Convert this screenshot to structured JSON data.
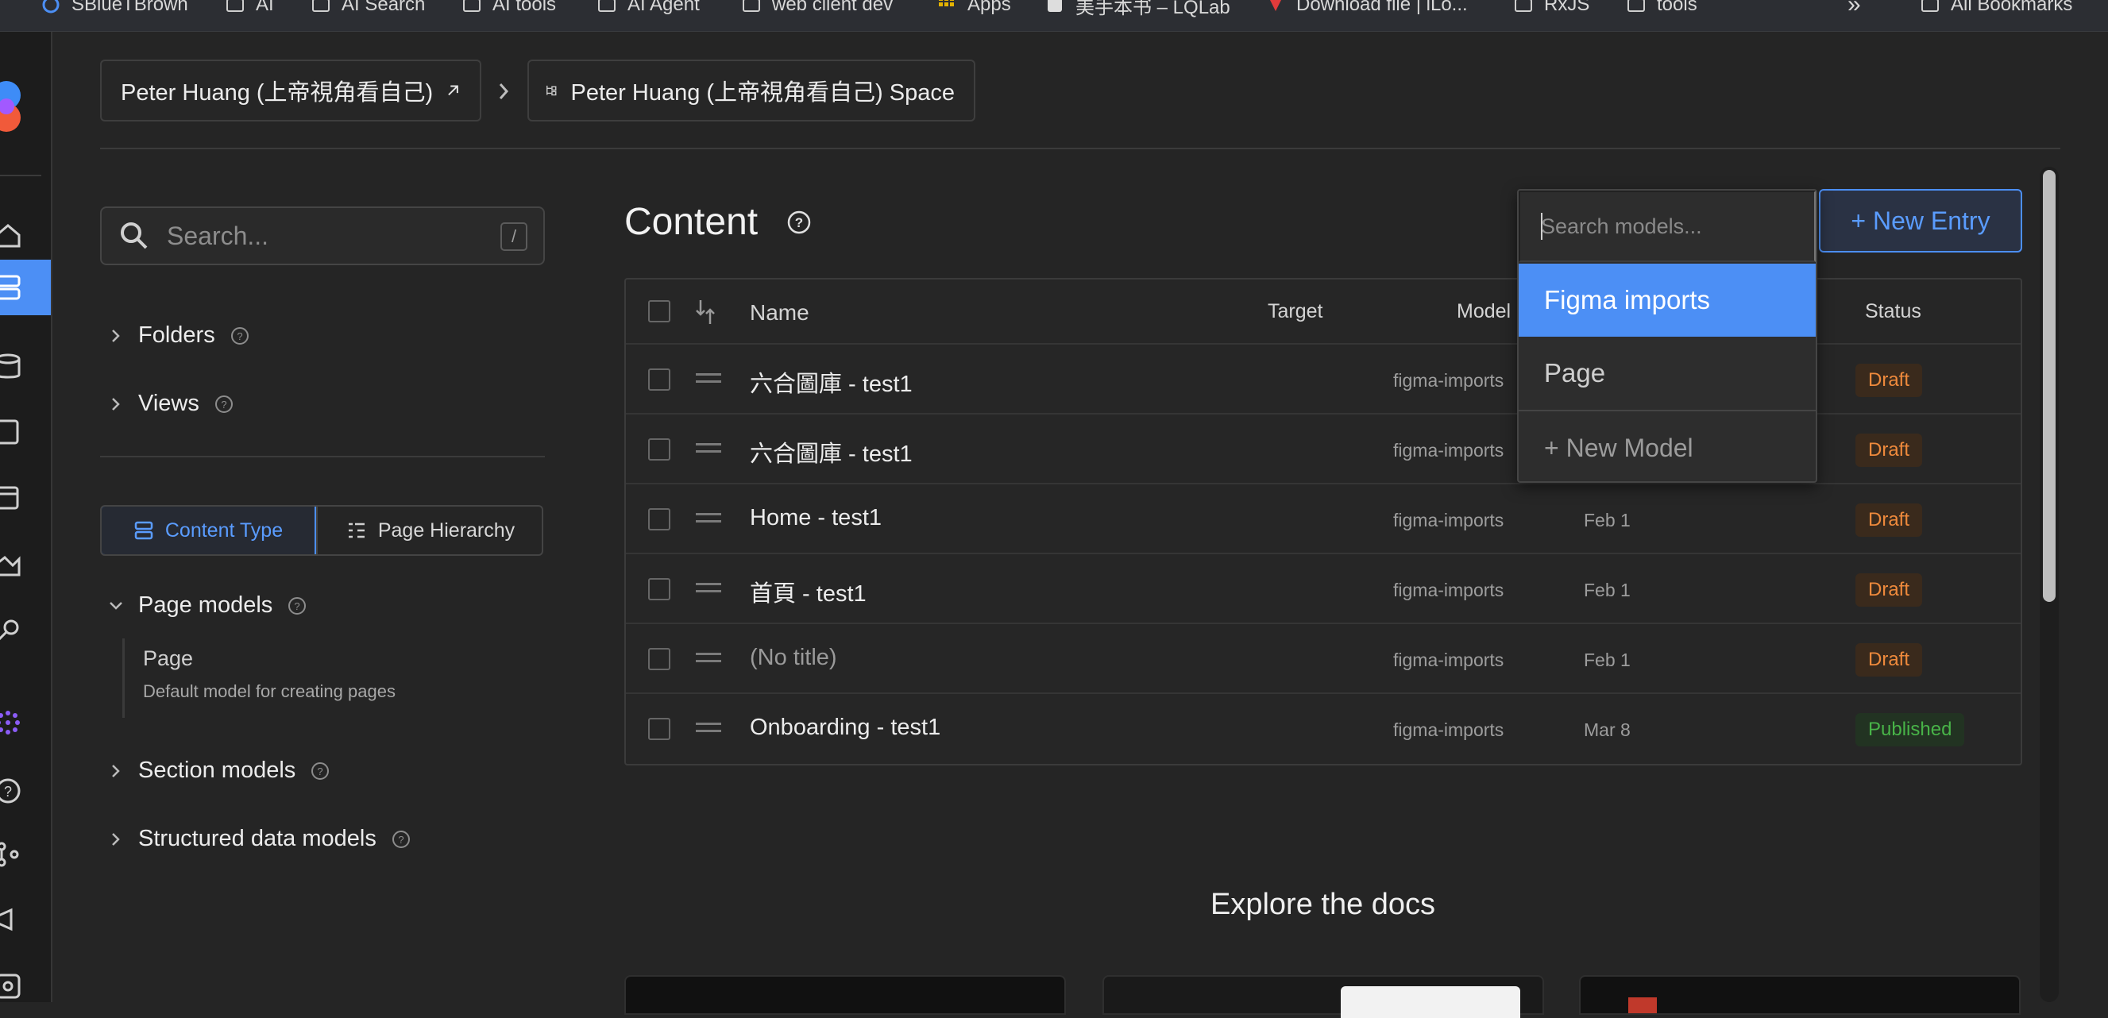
{
  "bookmarks": [
    {
      "label": "SBlueTBrown",
      "icon": "globe-icon"
    },
    {
      "label": "AI",
      "icon": "folder-icon"
    },
    {
      "label": "AI Search",
      "icon": "folder-icon"
    },
    {
      "label": "AI tools",
      "icon": "folder-icon"
    },
    {
      "label": "AI Agent",
      "icon": "folder-icon"
    },
    {
      "label": "web client dev",
      "icon": "folder-icon"
    },
    {
      "label": "Apps",
      "icon": "apps-grid-icon"
    },
    {
      "label": "美手本书 – LQLab",
      "icon": "site-icon"
    },
    {
      "label": "Download file | iLo...",
      "icon": "download-site-icon"
    },
    {
      "label": "RxJS",
      "icon": "folder-icon"
    },
    {
      "label": "tools",
      "icon": "folder-icon"
    },
    {
      "label": "»",
      "icon": "overflow-icon"
    },
    {
      "label": "All Bookmarks",
      "icon": "folder-icon"
    }
  ],
  "breadcrumb": {
    "workspace": "Peter Huang (上帝視角看自己)",
    "space": "Peter Huang (上帝視角看自己) Space"
  },
  "sidebar": {
    "search_placeholder": "Search...",
    "search_shortcut": "/",
    "folders_label": "Folders",
    "views_label": "Views",
    "tabs": {
      "content_type": "Content Type",
      "page_hierarchy": "Page Hierarchy"
    },
    "page_models_label": "Page models",
    "page_model": {
      "title": "Page",
      "description": "Default model for creating pages"
    },
    "section_models_label": "Section models",
    "structured_models_label": "Structured data models"
  },
  "main": {
    "title": "Content",
    "new_entry_label": "+ New Entry",
    "columns": {
      "name": "Name",
      "target": "Target",
      "model": "Model",
      "updated_partial": "l",
      "status": "Status"
    },
    "rows": [
      {
        "name": "六合圖庫 - test1",
        "model": "figma-imports",
        "date": "",
        "status": "Draft"
      },
      {
        "name": "六合圖庫 - test1",
        "model": "figma-imports",
        "date": "",
        "status": "Draft"
      },
      {
        "name": "Home - test1",
        "model": "figma-imports",
        "date": "Feb 1",
        "status": "Draft"
      },
      {
        "name": "首頁 - test1",
        "model": "figma-imports",
        "date": "Feb 1",
        "status": "Draft"
      },
      {
        "name": "(No title)",
        "model": "figma-imports",
        "date": "Feb 1",
        "status": "Draft"
      },
      {
        "name": "Onboarding - test1",
        "model": "figma-imports",
        "date": "Mar 8",
        "status": "Published"
      }
    ],
    "explore_title": "Explore the docs"
  },
  "model_dropdown": {
    "search_placeholder": "Search models...",
    "options": [
      "Figma imports",
      "Page"
    ],
    "selected": "Figma imports",
    "new_model_label": "+ New Model"
  },
  "colors": {
    "accent": "#4c8ff5",
    "draft": "#ef8a3c",
    "published": "#48b348",
    "background": "#252525"
  }
}
